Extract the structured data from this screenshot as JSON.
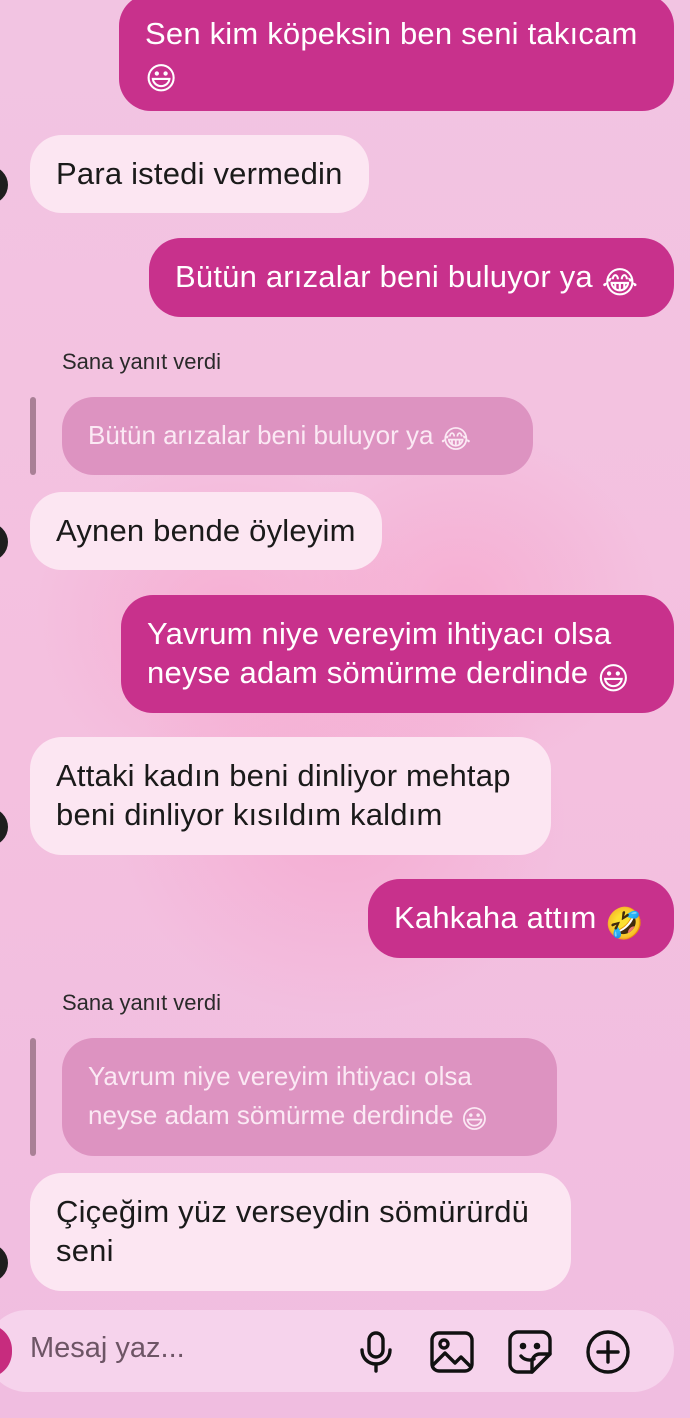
{
  "messages": [
    {
      "side": "out",
      "text": "Sen kim köpeksin ben seni takıcam",
      "emoji": "😃"
    },
    {
      "side": "in",
      "text": "Para istedi vermedin"
    },
    {
      "side": "out",
      "text": "Bütün arızalar beni buluyor ya",
      "emoji": "😂"
    },
    {
      "side": "in",
      "reply_label": "Sana yanıt verdi",
      "quote": "Bütün arızalar beni buluyor ya",
      "quote_emoji": "😂",
      "text": "Aynen bende öyleyim"
    },
    {
      "side": "out",
      "line1": "Yavrum niye vereyim ihtiyacı olsa",
      "line2": "neyse adam sömürme derdinde",
      "emoji": "😃"
    },
    {
      "side": "in",
      "line1": "Attaki kadın beni dinliyor mehtap",
      "line2": "beni dinliyor kısıldım kaldım"
    },
    {
      "side": "out",
      "text": "Kahkaha attım",
      "emoji": "🤣"
    },
    {
      "side": "in",
      "reply_label": "Sana yanıt verdi",
      "quote_line1": "Yavrum niye vereyim ihtiyacı olsa",
      "quote_line2": "neyse adam sömürme derdinde",
      "quote_emoji": "😃",
      "line1": "Çiçeğim yüz verseydin sömürürdü",
      "line2": "seni"
    }
  ],
  "composer": {
    "placeholder": "Mesaj yaz...",
    "icons": [
      "microphone-icon",
      "image-icon",
      "sticker-icon",
      "plus-circle-icon"
    ]
  },
  "colors": {
    "outgoing": "#c8318c",
    "incoming": "#fce6f2",
    "background": "#f1bfe0",
    "quote": "#dd93c1"
  }
}
